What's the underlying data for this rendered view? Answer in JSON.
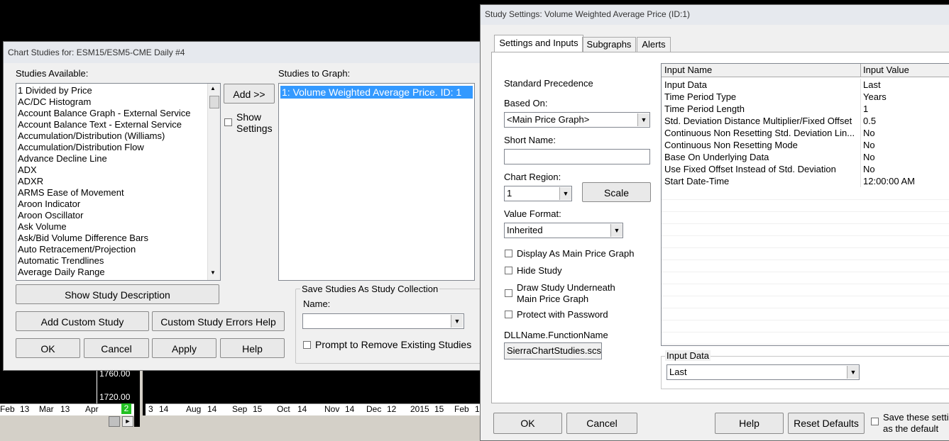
{
  "background_chart": {
    "price_labels": [
      "1760.00",
      "1720.00"
    ],
    "left_x_labels": [
      "Feb",
      "13",
      "Mar",
      "13",
      "Apr",
      "2"
    ],
    "right_x_labels": [
      "3",
      "14",
      "Aug",
      "14",
      "Sep",
      "15",
      "Oct",
      "14",
      "Nov",
      "14",
      "Dec",
      "12",
      "2015",
      "15",
      "Feb",
      "1"
    ]
  },
  "chart_studies": {
    "title": "Chart Studies for: ESM15/ESM5-CME  Daily  #4",
    "available_label": "Studies Available:",
    "available": [
      "1 Divided by Price",
      "AC/DC Histogram",
      "Account Balance Graph - External Service",
      "Account Balance Text - External Service",
      "Accumulation/Distribution (Williams)",
      "Accumulation/Distribution Flow",
      "Advance Decline Line",
      "ADX",
      "ADXR",
      "ARMS Ease of Movement",
      "Aroon Indicator",
      "Aroon Oscillator",
      "Ask Volume",
      "Ask/Bid Volume Difference Bars",
      "Auto Retracement/Projection",
      "Automatic Trendlines",
      "Average Daily Range"
    ],
    "add_label": "Add >>",
    "show_settings": "Show Settings",
    "to_graph_label": "Studies to Graph:",
    "to_graph": [
      "1: Volume Weighted Average Price. ID: 1"
    ],
    "show_description": "Show Study Description",
    "add_custom": "Add Custom Study",
    "custom_errors": "Custom Study Errors Help",
    "save_group": "Save Studies As Study Collection",
    "name_label": "Name:",
    "prompt_remove": "Prompt to Remove Existing Studies",
    "ok": "OK",
    "cancel": "Cancel",
    "apply": "Apply",
    "help": "Help"
  },
  "study_settings": {
    "title": "Study Settings: Volume Weighted Average Price (ID:1)",
    "tabs": [
      "Settings and Inputs",
      "Subgraphs",
      "Alerts"
    ],
    "standard_precedence": "Standard Precedence",
    "based_on_label": "Based On:",
    "based_on_value": "<Main Price Graph>",
    "short_name_label": "Short Name:",
    "short_name_value": "",
    "chart_region_label": "Chart Region:",
    "chart_region_value": "1",
    "scale": "Scale",
    "value_format_label": "Value Format:",
    "value_format_value": "Inherited",
    "display_main": "Display As Main Price Graph",
    "hide_study": "Hide Study",
    "draw_under_1": "Draw Study Underneath",
    "draw_under_2": "Main Price Graph",
    "protect": "Protect with Password",
    "dll_label": "DLLName.FunctionName",
    "dll_value": "SierraChartStudies.scs",
    "grid_headers": [
      "Input Name",
      "Input Value"
    ],
    "inputs": [
      {
        "name": "Input Data",
        "value": "Last"
      },
      {
        "name": "Time Period Type",
        "value": "Years"
      },
      {
        "name": "Time Period Length",
        "value": "1"
      },
      {
        "name": "Std. Deviation Distance Multiplier/Fixed Offset",
        "value": "0.5"
      },
      {
        "name": "Continuous Non Resetting Std. Deviation Lin...",
        "value": "No"
      },
      {
        "name": "Continuous Non Resetting Mode",
        "value": "No"
      },
      {
        "name": "Base On Underlying Data",
        "value": "No"
      },
      {
        "name": "Use Fixed Offset Instead of Std. Deviation",
        "value": "No"
      },
      {
        "name": "Start Date-Time",
        "value": "12:00:00 AM"
      }
    ],
    "input_group_label": "Input Data",
    "input_group_value": "Last",
    "ok": "OK",
    "cancel": "Cancel",
    "help": "Help",
    "reset": "Reset Defaults",
    "save_default_1": "Save these setti",
    "save_default_2": "as the default"
  }
}
